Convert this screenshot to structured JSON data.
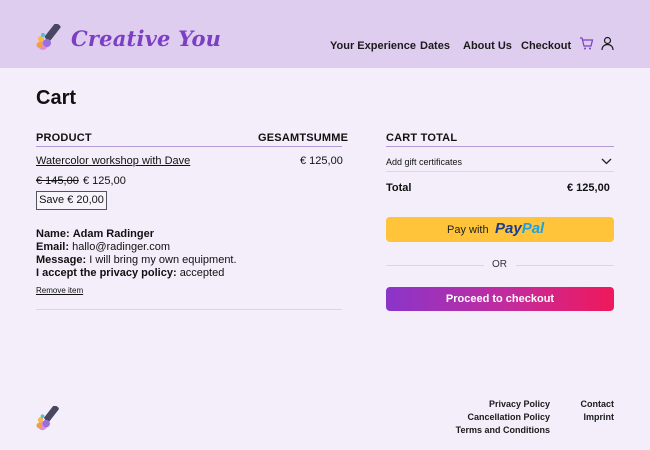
{
  "header": {
    "brand": "Creative You",
    "nav": [
      "Your Experience",
      "Dates",
      "About Us",
      "Checkout"
    ],
    "icons": [
      "cart-icon",
      "user-icon"
    ]
  },
  "page_title": "Cart",
  "cart": {
    "col_product": "PRODUCT",
    "col_total": "GESAMTSUMME",
    "item": {
      "name": "Watercolor workshop with Dave",
      "line_total": "€ 125,00",
      "old_price": "€ 145,00",
      "new_price": "€ 125,00",
      "save": "Save € 20,00",
      "meta": [
        {
          "label": "Name:",
          "value": "Adam Radinger",
          "value_bold": true
        },
        {
          "label": "Email:",
          "value": "hallo@radinger.com",
          "value_bold": false
        },
        {
          "label": "Message:",
          "value": "I will bring my own equipment.",
          "value_bold": false
        },
        {
          "label": "I accept the privacy policy:",
          "value": "accepted",
          "value_bold": false
        }
      ],
      "remove": "Remove item"
    }
  },
  "totals": {
    "heading": "CART TOTAL",
    "gift": "Add gift certificates",
    "total_label": "Total",
    "total_value": "€ 125,00",
    "paypal_prefix": "Pay with",
    "paypal_brand_a": "Pay",
    "paypal_brand_b": "Pal",
    "or": "OR",
    "checkout": "Proceed to checkout"
  },
  "footer": {
    "links_a": [
      "Privacy Policy",
      "Cancellation Policy",
      "Terms and Conditions"
    ],
    "links_b": [
      "Contact",
      "Imprint"
    ]
  },
  "colors": {
    "header_bg": "#dfcdf0",
    "page_bg": "#f3eefa",
    "brand": "#7b3fc4",
    "paypal": "#ffc439"
  }
}
